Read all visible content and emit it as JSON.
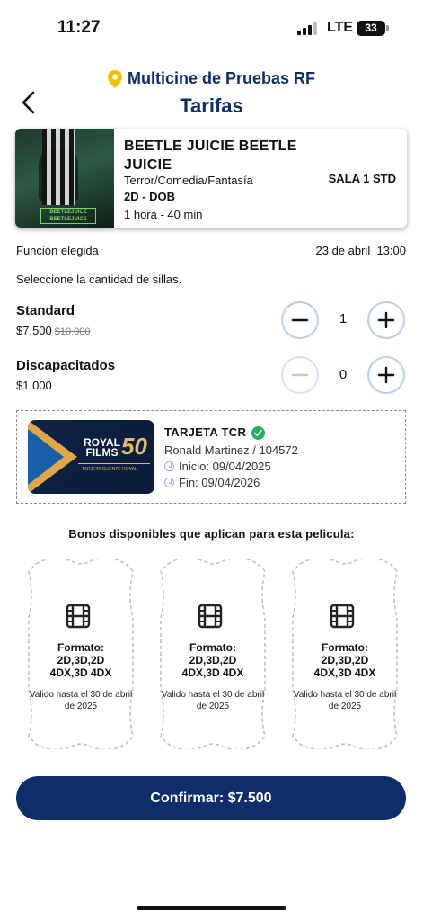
{
  "status_bar": {
    "time": "11:27",
    "network": "LTE",
    "battery": "33"
  },
  "header": {
    "cinema_name": "Multicine de Pruebas RF",
    "title": "Tarifas"
  },
  "movie": {
    "title": "BEETLE JUICIE BEETLE JUICIE",
    "genre": "Terror/Comedia/Fantasía",
    "format": "2D - DOB",
    "duration": "1 hora - 40 min",
    "sala": "SALA 1 STD",
    "poster_logo": "BEETLEJUICE BEETLEJUICE"
  },
  "function": {
    "label": "Función elegida",
    "date": "23 de abril",
    "time": "13:00"
  },
  "instruction": "Seleccione la cantidad de sillas.",
  "tickets": [
    {
      "name": "Standard",
      "price": "$7.500",
      "old_price": "$10.000",
      "quantity": "1"
    },
    {
      "name": "Discapacitados",
      "price": "$1.000",
      "quantity": "0"
    }
  ],
  "card": {
    "title": "TARJETA TCR",
    "holder": "Ronald Martinez / 104572",
    "start": "Inicio: 09/04/2025",
    "end": "Fin: 09/04/2026",
    "brand_line1": "ROYAL",
    "brand_line2": "FILMS",
    "brand_number": "50",
    "brand_sub": "TARJETA CLIENTE ROYAL"
  },
  "bonos": {
    "title": "Bonos disponibles que aplican para esta pelicula:",
    "items": [
      {
        "format_label": "Formato:",
        "formats_line1": "2D,3D,2D",
        "formats_line2": "4DX,3D 4DX",
        "valid": "Valido hasta el 30 de abril de 2025"
      },
      {
        "format_label": "Formato:",
        "formats_line1": "2D,3D,2D",
        "formats_line2": "4DX,3D 4DX",
        "valid": "Valido hasta el 30 de abril de 2025"
      },
      {
        "format_label": "Formato:",
        "formats_line1": "2D,3D,2D",
        "formats_line2": "4DX,3D 4DX",
        "valid": "Valido hasta el 30 de abril de 2025"
      }
    ]
  },
  "confirm_label": "Confirmar: $7.500",
  "colors": {
    "primary": "#0d2d6b",
    "accent_pin": "#f2c200",
    "verified": "#27ae60",
    "stepper_border": "#b9cdea"
  }
}
